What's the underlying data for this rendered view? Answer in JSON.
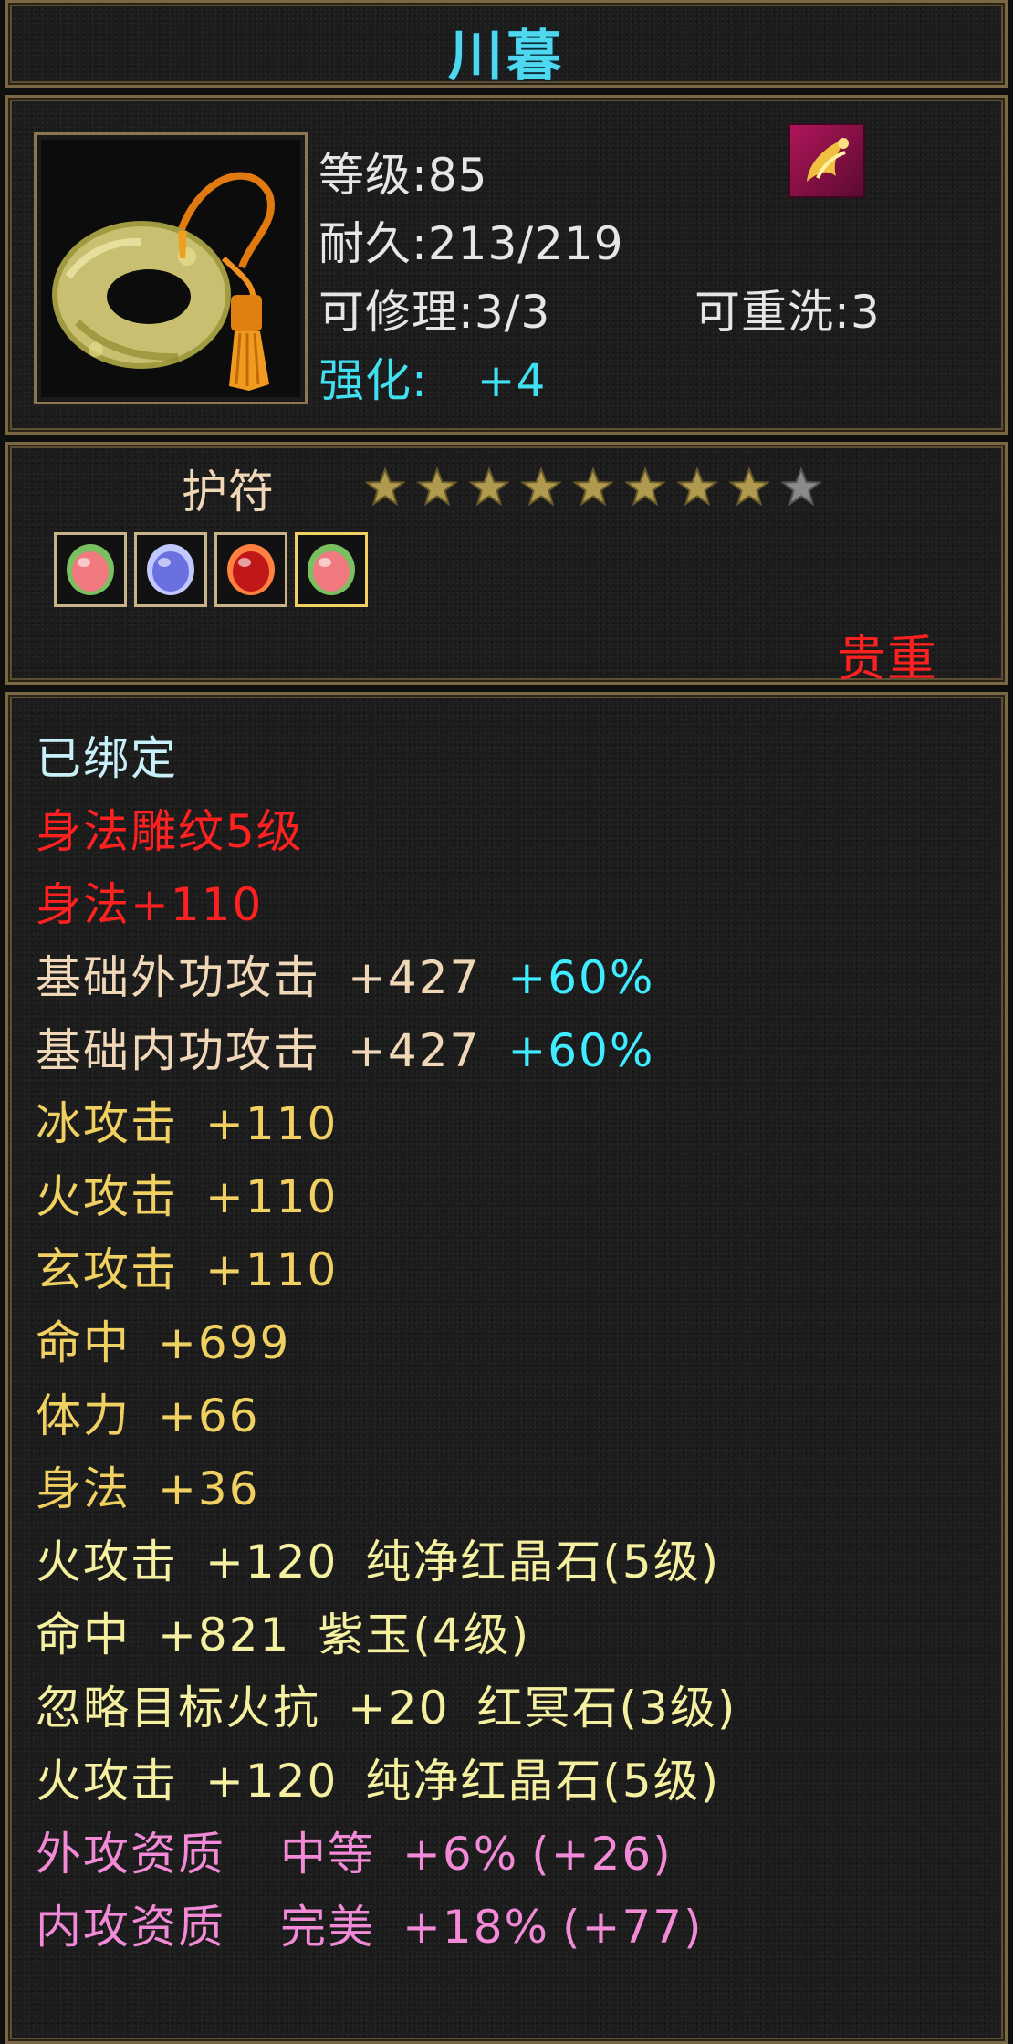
{
  "title": "川暮",
  "item": {
    "level": "等级:85",
    "durability": "耐久:213/219",
    "repairable": "可修理:3/3",
    "rewash": "可重洗:3",
    "enhance_label": "强化:",
    "enhance_value": "+4"
  },
  "category": "护符",
  "stars": {
    "filled": 8,
    "total": 9
  },
  "gems": [
    "green-gem",
    "blue-gem",
    "red-gem",
    "green-gem"
  ],
  "rarity": "贵重",
  "attributes": [
    {
      "segments": [
        "已绑定"
      ],
      "color": "#c8f0f8"
    },
    {
      "segments": [
        "身法雕纹5级"
      ],
      "color": "#ff2020"
    },
    {
      "segments": [
        "身法+110"
      ],
      "color": "#ff2020"
    },
    {
      "segments": [
        "基础外功攻击",
        "+427",
        "+60%"
      ],
      "color": "#efd7b8"
    },
    {
      "segments": [
        "基础内功攻击",
        "+427",
        "+60%"
      ],
      "color": "#efd7b8"
    },
    {
      "segments": [
        "冰攻击",
        "+110"
      ],
      "color": "#f0d060"
    },
    {
      "segments": [
        "火攻击",
        "+110"
      ],
      "color": "#f0d060"
    },
    {
      "segments": [
        "玄攻击",
        "+110"
      ],
      "color": "#f0d060"
    },
    {
      "segments": [
        "命中",
        "+699"
      ],
      "color": "#f0d060"
    },
    {
      "segments": [
        "体力",
        "+66"
      ],
      "color": "#f0d060"
    },
    {
      "segments": [
        "身法",
        "+36"
      ],
      "color": "#f0d060"
    },
    {
      "segments": [
        "火攻击",
        "+120",
        "纯净红晶石(5级)"
      ],
      "color": "#f5f0a0"
    },
    {
      "segments": [
        "命中",
        "+821",
        "紫玉(4级)"
      ],
      "color": "#f5f0a0"
    },
    {
      "segments": [
        "忽略目标火抗",
        "+20",
        "红冥石(3级)"
      ],
      "color": "#f5f0a0"
    },
    {
      "segments": [
        "火攻击",
        "+120",
        "纯净红晶石(5级)"
      ],
      "color": "#f5f0a0"
    },
    {
      "segments": [
        "外攻资质",
        "中等",
        "+6%",
        "(+26)"
      ],
      "color": "#f28ad8"
    },
    {
      "segments": [
        "内攻资质",
        "完美",
        "+18%",
        "(+77)"
      ],
      "color": "#f28ad8"
    }
  ]
}
